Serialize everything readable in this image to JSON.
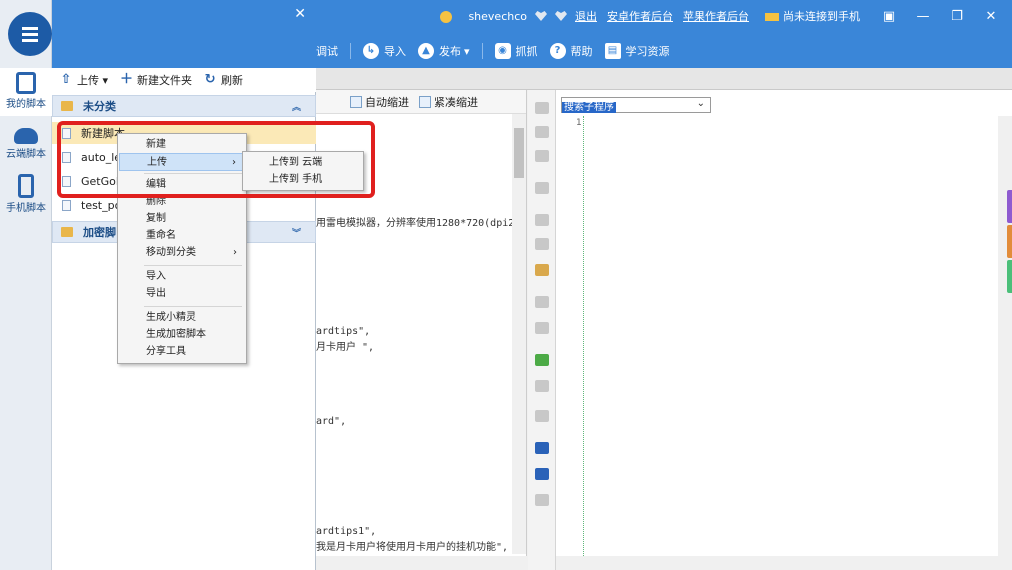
{
  "topbar": {
    "user": "shevechco",
    "links": [
      "退出",
      "安卓作者后台",
      "苹果作者后台"
    ],
    "phone_status": "尚未连接到手机",
    "window_controls": [
      "restore-small",
      "minimize",
      "maximize",
      "close"
    ]
  },
  "toolbar": {
    "items": [
      {
        "label": "调试",
        "icon": ""
      },
      {
        "label": "导入",
        "icon": "import-icon"
      },
      {
        "label": "发布",
        "icon": "publish-icon"
      },
      {
        "label": "抓抓",
        "icon": "camera-icon"
      },
      {
        "label": "帮助",
        "icon": "help-icon"
      },
      {
        "label": "学习资源",
        "icon": "book-icon"
      }
    ]
  },
  "leftnav": {
    "items": [
      {
        "label": "我的脚本",
        "icon": "document-icon",
        "active": true
      },
      {
        "label": "云端脚本",
        "icon": "cloud-icon",
        "active": false
      },
      {
        "label": "手机脚本",
        "icon": "phone-icon",
        "active": false
      }
    ]
  },
  "tree": {
    "actions": [
      {
        "label": "上传 ▾",
        "icon": "upload-icon"
      },
      {
        "label": "新建文件夹",
        "icon": "plus-icon"
      },
      {
        "label": "刷新",
        "icon": "refresh-icon"
      }
    ],
    "group1": {
      "label": "未分类",
      "collapse": "︽"
    },
    "files": [
      "新建脚本",
      "auto_lei",
      "GetGold",
      "test_poi"
    ],
    "group2": {
      "label": "加密脚",
      "collapse": "︾"
    }
  },
  "contextmenu": {
    "items": [
      {
        "label": "新建"
      },
      {
        "label": "上传",
        "submenu": true
      },
      {
        "label": "编辑"
      },
      {
        "label": "删除"
      },
      {
        "label": "复制"
      },
      {
        "label": "重命名"
      },
      {
        "label": "移动到分类",
        "submenu": true
      },
      {
        "label": "导入"
      },
      {
        "label": "导出"
      },
      {
        "label": "生成小精灵"
      },
      {
        "label": "生成加密脚本"
      },
      {
        "label": "分享工具"
      }
    ],
    "submenu": [
      "上传到 云端",
      "上传到 手机"
    ]
  },
  "editor": {
    "tools": [
      "自动缩进",
      "紧凑缩进"
    ],
    "lines": [
      "用雷电模拟器，分辨率使用1280*720(dpi2",
      "ardtips\",",
      "月卡用户  \",",
      "ard\",",
      "ardtips1\",",
      "我是月卡用户将使用月卡用户的挂机功能\","
    ]
  },
  "rightpane": {
    "selector_value": "搜索子程序",
    "line_number": "1"
  },
  "colors": {
    "accent": "#3a86d8",
    "nav_blue": "#1d5ba6",
    "highlight": "#e0201e",
    "tab_colors": [
      "#8e5bd0",
      "#e28c3a",
      "#4bbf79"
    ]
  }
}
